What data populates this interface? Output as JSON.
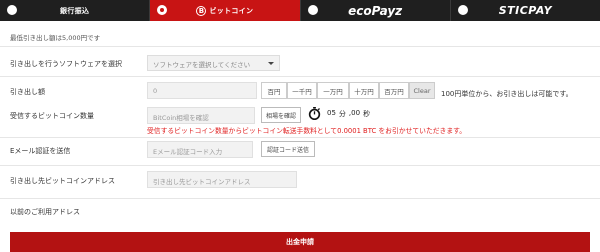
{
  "tabs": [
    {
      "label": "銀行振込",
      "active": false
    },
    {
      "label": "ビットコイン",
      "active": true
    },
    {
      "label": "ecoPayz",
      "active": false
    },
    {
      "label": "STICPAY",
      "active": false
    }
  ],
  "min_withdraw_note": "最低引き出し額は5,000円です",
  "software": {
    "label": "引き出しを行うソフトウェアを選択",
    "placeholder": "ソフトウェアを選択してください"
  },
  "amount": {
    "label": "引き出し額",
    "value": "0",
    "quick_buttons": [
      "百円",
      "一千円",
      "一万円",
      "十万円",
      "百万円"
    ],
    "clear_label": "Clear",
    "unit_note": "100円単位から、お引き出しは可能です。"
  },
  "bitcoin": {
    "label": "受信するビットコイン数量",
    "placeholder": "BitCoin相場を確認",
    "check_button": "相場を確認",
    "timer_minutes": "05",
    "timer_min_unit": "分",
    "timer_seconds": ",00",
    "timer_sec_unit": "秒",
    "fee_note": "受信するビットコイン数量からビットコイン転送手数料として0.0001 BTC をお引かせていただきます。"
  },
  "email": {
    "label": "Eメール認証を送信",
    "placeholder": "Eメール認証コード入力",
    "send_button": "認証コード送信"
  },
  "address": {
    "label": "引き出し先ビットコインアドレス",
    "placeholder": "引き出し先ビットコインアドレス"
  },
  "previous_address_label": "以前のご利用アドレス",
  "submit_label": "出金申請",
  "colors": {
    "accent": "#c81414",
    "tab_bg": "#1f1f1f",
    "warning_text": "#e02020"
  },
  "icons": [
    "bitcoin-icon",
    "stopwatch-icon",
    "dropdown-caret-icon"
  ]
}
